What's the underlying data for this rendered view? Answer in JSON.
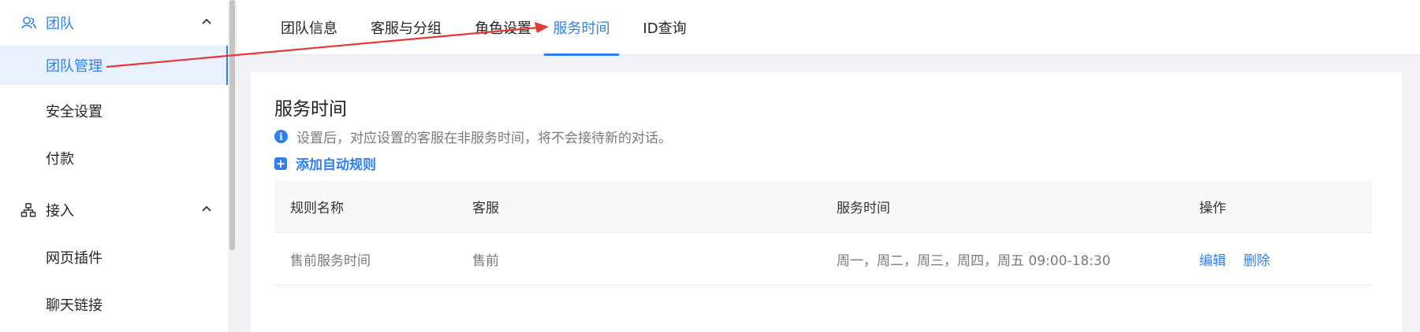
{
  "sidebar": {
    "groups": [
      {
        "label": "团队",
        "icon": "team-icon"
      },
      {
        "label": "接入",
        "icon": "network-icon"
      }
    ],
    "items": [
      {
        "label": "团队管理"
      },
      {
        "label": "安全设置"
      },
      {
        "label": "付款"
      },
      {
        "label": "网页插件"
      },
      {
        "label": "聊天链接"
      }
    ]
  },
  "tabs": [
    {
      "label": "团队信息"
    },
    {
      "label": "客服与分组"
    },
    {
      "label": "角色设置"
    },
    {
      "label": "服务时间"
    },
    {
      "label": "ID查询"
    }
  ],
  "main": {
    "title": "服务时间",
    "notice": "设置后，对应设置的客服在非服务时间，将不会接待新的对话。",
    "add_rule": "添加自动规则",
    "table": {
      "headers": [
        "规则名称",
        "客服",
        "服务时间",
        "操作"
      ],
      "rows": [
        {
          "name": "售前服务时间",
          "agent": "售前",
          "time": "周一，周二，周三，周四，周五 09:00-18:30",
          "edit": "编辑",
          "delete": "删除"
        }
      ]
    }
  },
  "colors": {
    "accent": "#2f7ff3",
    "annotation_arrow": "#e53935"
  }
}
